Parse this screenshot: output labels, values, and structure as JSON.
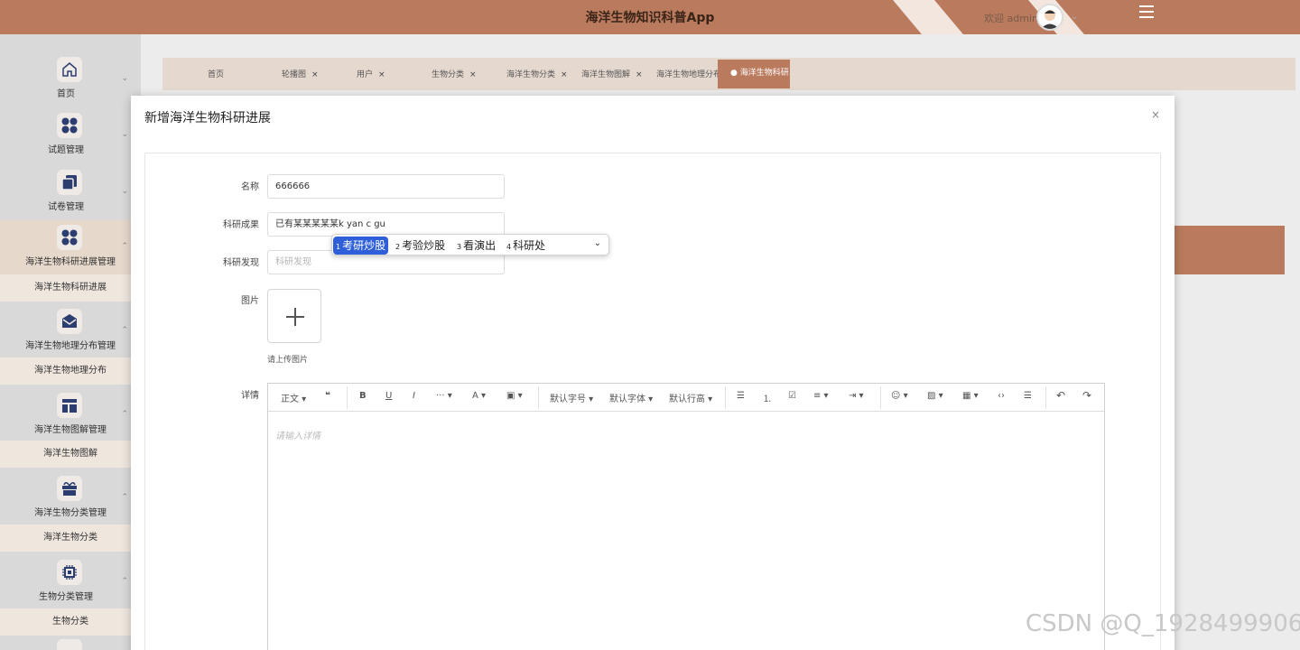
{
  "header": {
    "title": "海洋生物知识科普App",
    "welcome": "欢迎 admin"
  },
  "sidebar": {
    "groups": [
      {
        "label": "首页",
        "icon": "home-icon"
      },
      {
        "label": "试题管理",
        "icon": "apps-icon"
      },
      {
        "label": "试卷管理",
        "icon": "copy-icon"
      },
      {
        "label": "海洋生物科研进展管理",
        "icon": "apps-icon",
        "sub": "海洋生物科研进展"
      },
      {
        "label": "海洋生物地理分布管理",
        "icon": "mail-icon",
        "sub": "海洋生物地理分布"
      },
      {
        "label": "海洋生物图解管理",
        "icon": "layout-icon",
        "sub": "海洋生物图解"
      },
      {
        "label": "海洋生物分类管理",
        "icon": "gift-icon",
        "sub": "海洋生物分类"
      },
      {
        "label": "生物分类管理",
        "icon": "chip-icon",
        "sub": "生物分类"
      }
    ]
  },
  "tabs": {
    "items": [
      "首页",
      "轮播图",
      "用户",
      "生物分类",
      "海洋生物分类",
      "海洋生物图解",
      "海洋生物地理分布"
    ],
    "active": "● 海洋生物科研…",
    "close": "×"
  },
  "modal": {
    "title": "新增海洋生物科研进展",
    "close": "×",
    "fields": {
      "name_label": "名称",
      "name_value": "666666",
      "result_label": "科研成果",
      "result_value": "已有某某某某某k yan c gu",
      "discovery_label": "科研发现",
      "discovery_placeholder": "科研发现",
      "image_label": "图片",
      "image_hint": "请上传图片",
      "detail_label": "详情",
      "detail_placeholder": "请输入详情"
    },
    "toolbar": {
      "paragraph": "正文 ▾",
      "quote": "❝",
      "bold": "B",
      "underline": "U",
      "italic": "I",
      "more": "··· ▾",
      "font_color": "A ▾",
      "bg_color": "▣ ▾",
      "font_size": "默认字号 ▾",
      "font_family": "默认字体 ▾",
      "line_height": "默认行高 ▾",
      "bullet_list": "☰",
      "numbered_list": "⒈",
      "todo": "☑",
      "align": "≡ ▾",
      "indent": "⇥ ▾",
      "emoji": "☺ ▾",
      "image": "▨ ▾",
      "table": "▦ ▾",
      "code": "‹›",
      "divider": "☰",
      "undo": "↶",
      "redo": "↷"
    }
  },
  "ime": {
    "candidates": [
      {
        "num": "1",
        "text": "考研炒股"
      },
      {
        "num": "2",
        "text": "考验炒股"
      },
      {
        "num": "3",
        "text": "看演出"
      },
      {
        "num": "4",
        "text": "科研处"
      }
    ]
  },
  "watermark": "CSDN @Q_1928499906",
  "colors": {
    "brand": "#b97a5d",
    "ime_highlight": "#2e5fd8"
  }
}
